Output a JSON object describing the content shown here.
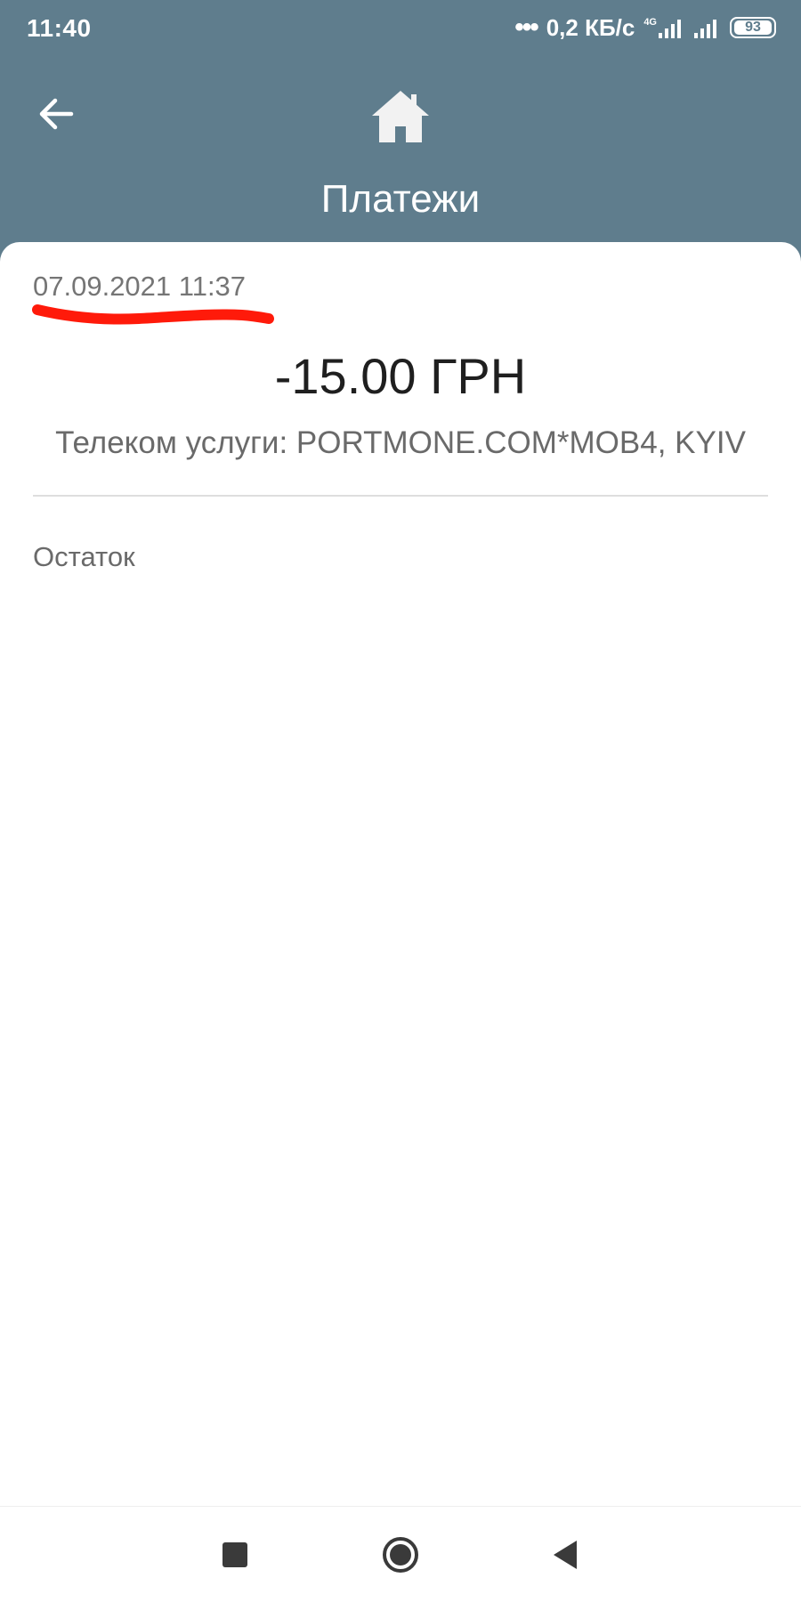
{
  "status_bar": {
    "time": "11:40",
    "network_speed": "0,2 КБ/с",
    "network_type": "4G",
    "battery": "93",
    "icons": [
      "dots-icon",
      "signal-icon",
      "signal-icon",
      "battery-icon"
    ]
  },
  "header": {
    "title": "Платежи",
    "back_icon": "arrow-left-icon",
    "home_icon": "home-icon",
    "background_color": "#5f7d8d"
  },
  "transaction": {
    "datetime": "07.09.2021 11:37",
    "amount": "-15.00 ГРН",
    "description": "Телеком услуги: PORTMONE.COM*MOB4, KYIV",
    "annotation_color": "#ff1a0a"
  },
  "balance": {
    "label": "Остаток"
  },
  "nav_bar": {
    "icons": [
      "recents-square-icon",
      "home-circle-icon",
      "back-triangle-icon"
    ]
  }
}
